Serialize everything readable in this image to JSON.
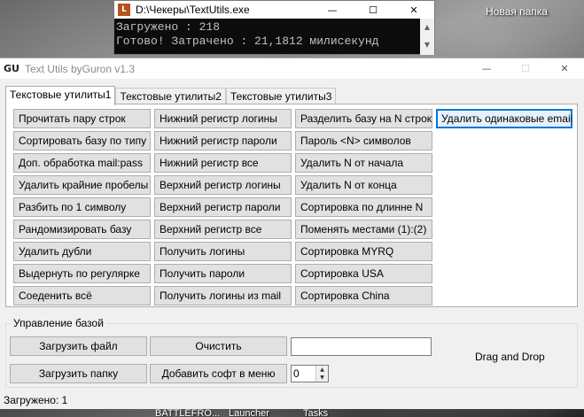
{
  "desktop": {
    "folder_label": "Новая папка",
    "taskbar_items": [
      "BATTLEFRO...",
      "Launcher",
      "Tasks"
    ]
  },
  "console": {
    "icon_letter": "L",
    "title": "D:\\Чекеры\\TextUtils.exe",
    "lines": [
      "Загружено : 218",
      "Готово! Затрачено : 21,1812 милисекунд"
    ],
    "controls": {
      "minimize": "—",
      "maximize": "☐",
      "close": "✕"
    }
  },
  "app": {
    "logo": "GU",
    "title": "Text Utils byGuron v1.3",
    "controls": {
      "minimize": "—",
      "maximize": "☐",
      "close": "✕"
    },
    "tabs": [
      "Текстовые утилиты1",
      "Текстовые утилиты2",
      "Текстовые утилиты3"
    ],
    "columns": [
      [
        "Прочитать пару строк",
        "Сортировать базу по типу",
        "Доп. обработка mail:pass",
        "Удалить крайние пробелы",
        "Разбить по 1 символу",
        "Рандомизировать базу",
        "Удалить дубли",
        "Выдернуть по регулярке",
        "Соеденить всё"
      ],
      [
        "Нижний регистр логины",
        "Нижний регистр пароли",
        "Нижний регистр все",
        "Верхний регистр логины",
        "Верхний регистр пароли",
        "Верхний регистр все",
        "Получить логины",
        "Получить пароли",
        "Получить логины из mail"
      ],
      [
        "Разделить базу на N строк",
        "Пароль <N> символов",
        "Удалить N от начала",
        "Удалить N от конца",
        "Сортировка по длинне N",
        "Поменять местами (1):(2)",
        "Сортировка MYRQ",
        "Сортировка USA",
        "Сортировка China"
      ],
      [
        "Удалить одинаковые email"
      ]
    ],
    "base": {
      "legend": "Управление базой",
      "load_file": "Загрузить файл",
      "clear": "Очистить",
      "load_folder": "Загрузить папку",
      "add_to_menu": "Добавить софт в меню",
      "input_value": "",
      "spin_value": "0",
      "drag_drop": "Drag and Drop"
    },
    "status": "Загружено: 1"
  }
}
